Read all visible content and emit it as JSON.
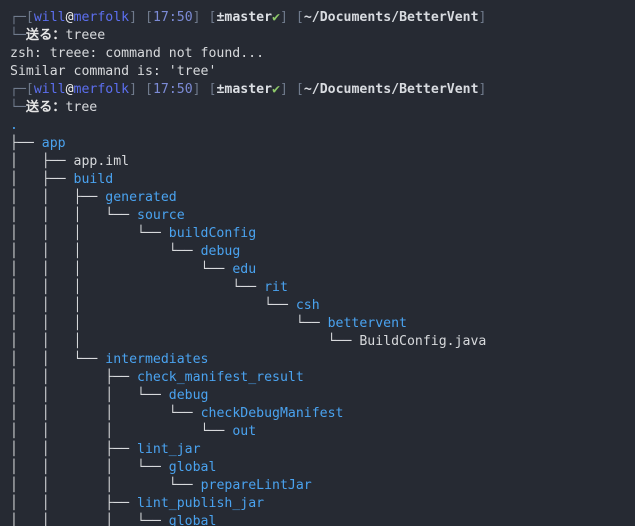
{
  "colors": {
    "background": "#262a33",
    "directory": "#4aa3f0",
    "file": "#d7d9dc",
    "prompt_user": "#5c6ff0",
    "git_check": "#8ec96a"
  },
  "prompt": {
    "user": "will",
    "at": "@",
    "host": "merfolk",
    "time": "17:50",
    "git_branch": "±master",
    "git_check_icon": "check-icon",
    "git_check": "✔",
    "path": "~/Documents/BetterVent",
    "prompt_char": "送る："
  },
  "commands": [
    {
      "text": "treee"
    },
    {
      "text": "tree"
    }
  ],
  "output": [
    "zsh: treee: command not found...",
    "Similar command is: 'tree'"
  ],
  "tree": {
    "root": ".",
    "rows": [
      {
        "indent": 0,
        "conn": "├── ",
        "name": "app",
        "kind": "dir"
      },
      {
        "indent": 1,
        "conn": "├── ",
        "name": "app.iml",
        "kind": "file"
      },
      {
        "indent": 1,
        "conn": "├── ",
        "name": "build",
        "kind": "dir"
      },
      {
        "indent": 2,
        "conn": "├── ",
        "name": "generated",
        "kind": "dir"
      },
      {
        "indent": 3,
        "conn": "└── ",
        "name": "source",
        "kind": "dir"
      },
      {
        "indent": 4,
        "conn": "└── ",
        "name": "buildConfig",
        "kind": "dir"
      },
      {
        "indent": 5,
        "conn": "└── ",
        "name": "debug",
        "kind": "dir"
      },
      {
        "indent": 6,
        "conn": "└── ",
        "name": "edu",
        "kind": "dir"
      },
      {
        "indent": 7,
        "conn": "└── ",
        "name": "rit",
        "kind": "dir"
      },
      {
        "indent": 8,
        "conn": "└── ",
        "name": "csh",
        "kind": "dir"
      },
      {
        "indent": 9,
        "conn": "└── ",
        "name": "bettervent",
        "kind": "dir"
      },
      {
        "indent": 10,
        "conn": "└── ",
        "name": "BuildConfig.java",
        "kind": "file"
      },
      {
        "indent": 2,
        "conn": "└── ",
        "name": "intermediates",
        "kind": "dir"
      },
      {
        "indent": 3,
        "conn": "├── ",
        "name": "check_manifest_result",
        "kind": "dir"
      },
      {
        "indent": 4,
        "conn": "└── ",
        "name": "debug",
        "kind": "dir"
      },
      {
        "indent": 5,
        "conn": "└── ",
        "name": "checkDebugManifest",
        "kind": "dir"
      },
      {
        "indent": 6,
        "conn": "└── ",
        "name": "out",
        "kind": "dir"
      },
      {
        "indent": 3,
        "conn": "├── ",
        "name": "lint_jar",
        "kind": "dir"
      },
      {
        "indent": 4,
        "conn": "└── ",
        "name": "global",
        "kind": "dir"
      },
      {
        "indent": 5,
        "conn": "└── ",
        "name": "prepareLintJar",
        "kind": "dir"
      },
      {
        "indent": 3,
        "conn": "├── ",
        "name": "lint_publish_jar",
        "kind": "dir"
      },
      {
        "indent": 4,
        "conn": "└── ",
        "name": "global",
        "kind": "dir"
      }
    ]
  }
}
